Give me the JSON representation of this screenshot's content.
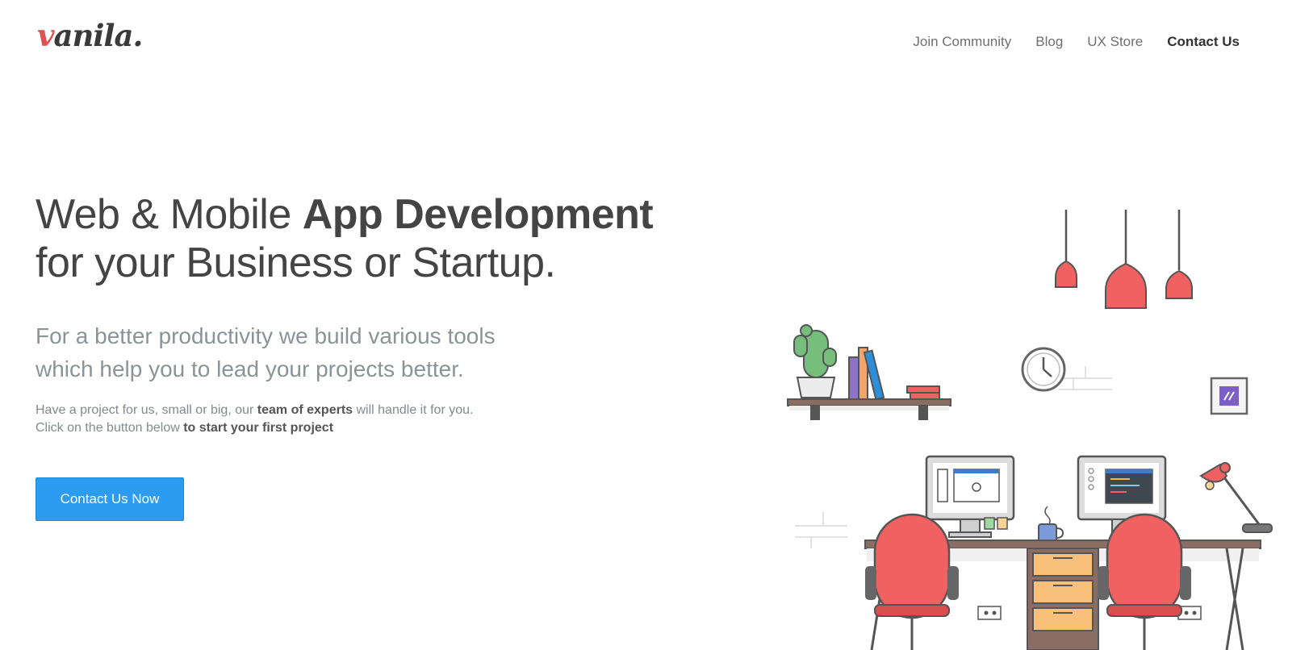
{
  "brand": {
    "logo_accent": "v",
    "logo_rest": "anila."
  },
  "nav": {
    "items": [
      {
        "label": "Join Community"
      },
      {
        "label": "Blog"
      },
      {
        "label": "UX Store"
      },
      {
        "label": "Contact Us"
      }
    ]
  },
  "hero": {
    "headline_part1": "Web & Mobile ",
    "headline_strong": "App Development",
    "headline_part2": "for your Business or Startup.",
    "lead_line1": "For a better productivity we build various tools",
    "lead_line2": "which help you to lead your projects better.",
    "desc_prefix": "Have a project for us, small or big, our ",
    "desc_strong1": "team of experts",
    "desc_suffix": " will handle it for you.",
    "desc_line2_prefix": "Click on the button below ",
    "desc_strong2": "to start your first project",
    "cta_label": "Contact Us Now"
  },
  "colors": {
    "brand_accent": "#e0524f",
    "button": "#2b9cf2",
    "heading": "#444444",
    "muted": "#8c9398"
  }
}
